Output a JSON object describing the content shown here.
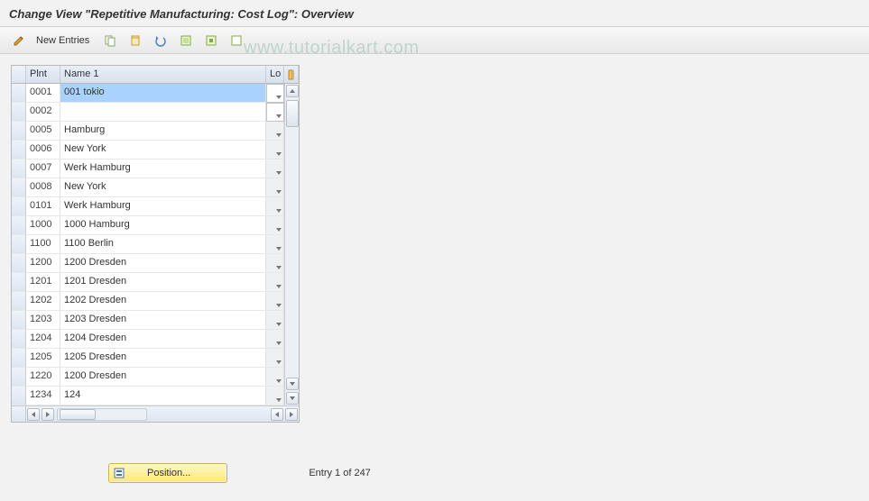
{
  "title": "Change View \"Repetitive Manufacturing: Cost Log\": Overview",
  "toolbar": {
    "new_entries": "New Entries"
  },
  "watermark": "www.tutorialkart.com",
  "columns": {
    "plnt": "Plnt",
    "name": "Name 1",
    "lo": "Lo"
  },
  "rows": [
    {
      "plnt": "0001",
      "name": "001 tokio",
      "box": true
    },
    {
      "plnt": "0002",
      "name": "",
      "box": true
    },
    {
      "plnt": "0005",
      "name": "Hamburg"
    },
    {
      "plnt": "0006",
      "name": "New York"
    },
    {
      "plnt": "0007",
      "name": "Werk Hamburg"
    },
    {
      "plnt": "0008",
      "name": "New York"
    },
    {
      "plnt": "0101",
      "name": "Werk Hamburg"
    },
    {
      "plnt": "1000",
      "name": "1000 Hamburg"
    },
    {
      "plnt": "1100",
      "name": "1100 Berlin"
    },
    {
      "plnt": "1200",
      "name": "1200 Dresden"
    },
    {
      "plnt": "1201",
      "name": "1201 Dresden"
    },
    {
      "plnt": "1202",
      "name": "1202 Dresden"
    },
    {
      "plnt": "1203",
      "name": "1203 Dresden"
    },
    {
      "plnt": "1204",
      "name": "1204 Dresden"
    },
    {
      "plnt": "1205",
      "name": "1205 Dresden"
    },
    {
      "plnt": "1220",
      "name": "1200 Dresden"
    },
    {
      "plnt": "1234",
      "name": "124"
    }
  ],
  "position_button": "Position...",
  "entry_status": "Entry 1 of 247"
}
